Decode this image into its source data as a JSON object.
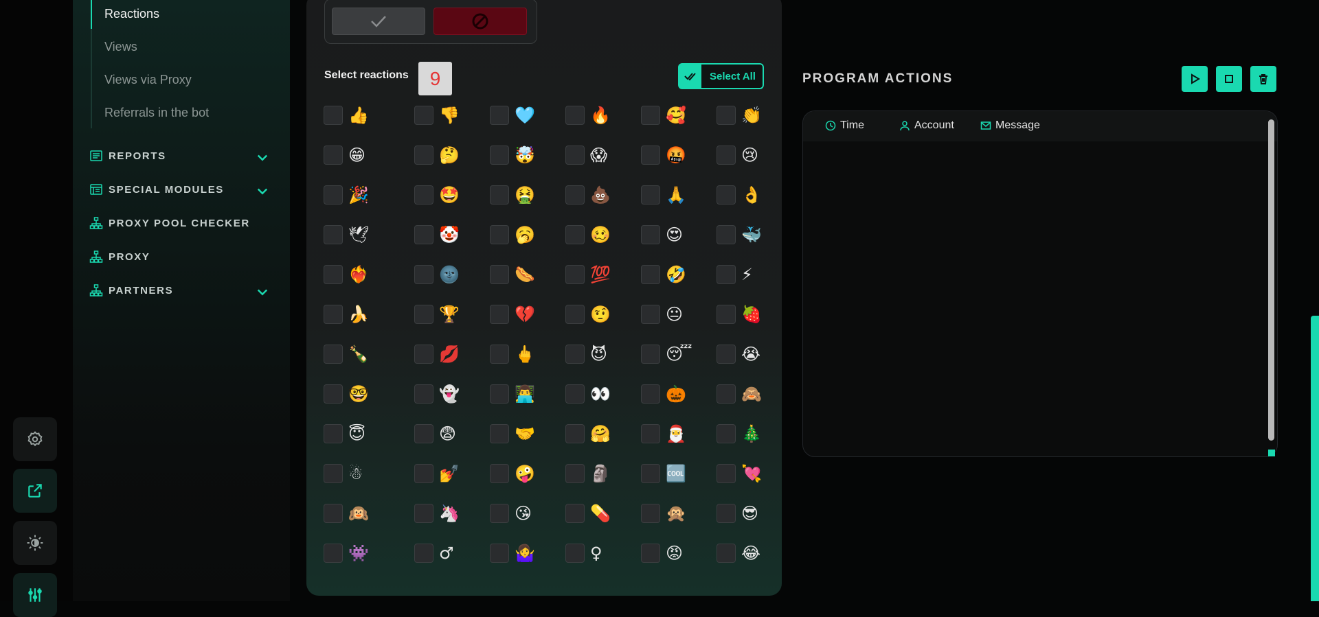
{
  "sidebar": {
    "sub_items": [
      "Reactions",
      "Views",
      "Views via Proxy",
      "Referrals in the bot"
    ],
    "nav": [
      {
        "label": "REPORTS",
        "icon": "report-icon",
        "has_chevron": true
      },
      {
        "label": "SPECIAL MODULES",
        "icon": "modules-icon",
        "has_chevron": true
      },
      {
        "label": "PROXY POOL CHECKER",
        "icon": "network-icon",
        "has_chevron": false
      },
      {
        "label": "PROXY",
        "icon": "network-icon",
        "has_chevron": false
      },
      {
        "label": "PARTNERS",
        "icon": "network-icon",
        "has_chevron": true
      }
    ]
  },
  "rail": {
    "buttons": [
      "settings-icon",
      "external-link-icon",
      "theme-toggle-icon",
      "sliders-icon"
    ]
  },
  "reactions": {
    "select_label": "Select reactions",
    "count": "9",
    "select_all_label": "Select All",
    "rows": [
      [
        "👍",
        "👎",
        "🩵",
        "🔥",
        "🥰",
        "👏"
      ],
      [
        "😁",
        "🤔",
        "🤯",
        "😱",
        "🤬",
        "😢"
      ],
      [
        "🎉",
        "🤩",
        "🤮",
        "💩",
        "🙏",
        "👌"
      ],
      [
        "🕊",
        "🤡",
        "🥱",
        "🥴",
        "😍",
        "🐳"
      ],
      [
        "❤️‍🔥",
        "🌚",
        "🌭",
        "💯",
        "🤣",
        "⚡"
      ],
      [
        "🍌",
        "🏆",
        "💔",
        "🤨",
        "😐",
        "🍓"
      ],
      [
        "🍾",
        "💋",
        "🖕",
        "😈",
        "😴",
        "😭"
      ],
      [
        "🤓",
        "👻",
        "👨‍💻",
        "👀",
        "🎃",
        "🙈"
      ],
      [
        "😇",
        "😨",
        "🤝",
        "🤗",
        "🎅",
        "🎄"
      ],
      [
        "☃",
        "💅",
        "🤪",
        "🗿",
        "🆒",
        "💘"
      ],
      [
        "🙉",
        "🦄",
        "😘",
        "💊",
        "🙊",
        "😎"
      ],
      [
        "👾",
        "♂",
        "🤷‍♀️",
        "♀",
        "😡",
        "😂"
      ]
    ]
  },
  "program_actions": {
    "title": "PROGRAM ACTIONS",
    "columns": [
      {
        "label": "Time",
        "icon": "clock-icon"
      },
      {
        "label": "Account",
        "icon": "user-icon"
      },
      {
        "label": "Message",
        "icon": "mail-icon"
      }
    ]
  },
  "colors": {
    "accent": "#1ad9b0",
    "danger": "#5a0713",
    "count_text": "#e53535"
  }
}
